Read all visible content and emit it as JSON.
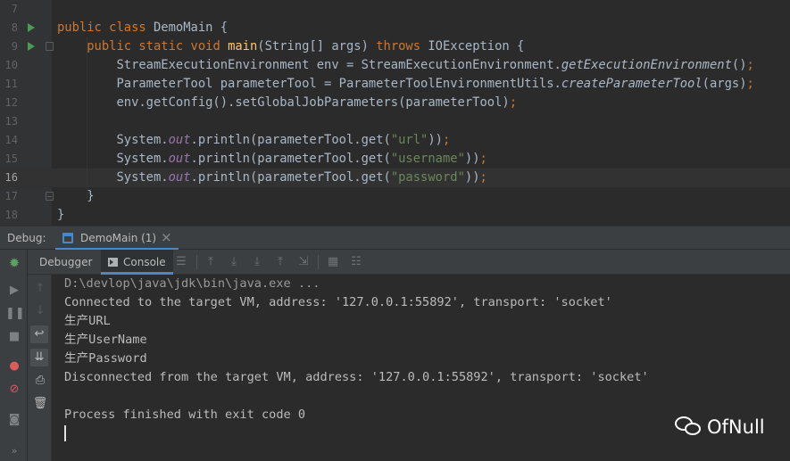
{
  "editor": {
    "line_numbers": [
      "7",
      "8",
      "9",
      "10",
      "11",
      "12",
      "13",
      "14",
      "15",
      "16",
      "17",
      "18"
    ],
    "current_line": "16"
  },
  "debug": {
    "label": "Debug:",
    "session_tab": "DemoMain (1)",
    "close_glyph": "×",
    "tabs": {
      "debugger": "Debugger",
      "console": "Console"
    }
  },
  "console": {
    "lines": [
      "D:\\devlop\\java\\jdk\\bin\\java.exe ...",
      "Connected to the target VM, address: '127.0.0.1:55892', transport: 'socket'",
      "生产URL",
      "生产UserName",
      "生产Password",
      "Disconnected from the target VM, address: '127.0.0.1:55892', transport: 'socket'",
      "",
      "Process finished with exit code 0"
    ]
  },
  "watermark": {
    "text": "OfNull"
  },
  "icons": {
    "run": "run-gutter-icon",
    "resume": "resume-icon",
    "pause": "pause-icon",
    "stop": "stop-icon",
    "breakpoints": "view-breakpoints-icon",
    "mute": "mute-breakpoints-icon",
    "camera": "camera-icon",
    "more": "more-icon"
  },
  "colors": {
    "keyword": "#cc7832",
    "method": "#ffc66d",
    "string": "#6a8759",
    "field": "#9876aa",
    "text": "#a9b7c6",
    "accent": "#4a88c7",
    "run": "#499c54"
  }
}
